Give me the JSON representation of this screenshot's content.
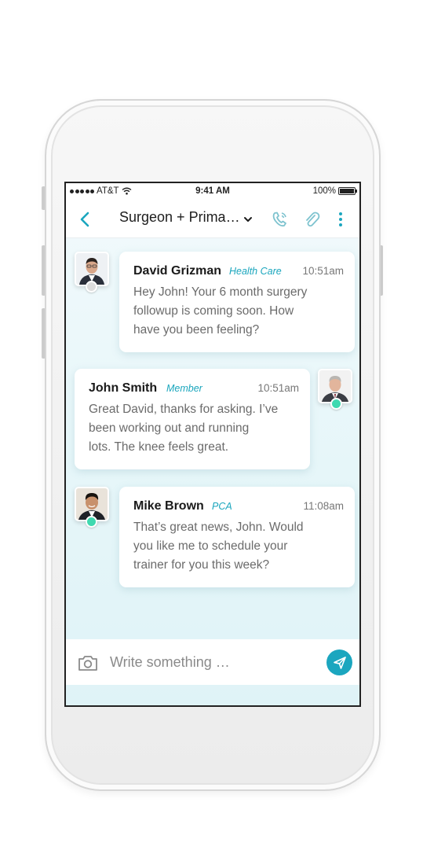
{
  "status_bar": {
    "carrier": "AT&T",
    "time": "9:41 AM",
    "battery": "100%"
  },
  "header": {
    "title": "Surgeon + Prima…",
    "icons": [
      "back-chevron-icon",
      "chevron-down-icon",
      "phone-icon",
      "paperclip-icon",
      "more-vertical-icon"
    ]
  },
  "messages": [
    {
      "sender": "David Grizman",
      "role": "Health Care",
      "time": "10:51am",
      "lines": [
        "Hey John! Your 6 month surgery",
        "followup is coming soon. How",
        "have you been feeling?"
      ],
      "presence": "offline"
    },
    {
      "sender": "John Smith",
      "role": "Member",
      "time": "10:51am",
      "lines": [
        "Great David, thanks for asking. I’ve",
        "been working out and running",
        "lots. The knee feels great."
      ],
      "presence": "online"
    },
    {
      "sender": "Mike Brown",
      "role": "PCA",
      "time": "11:08am",
      "lines": [
        "That’s great news, John. Would",
        "you like me to schedule your",
        "trainer for you this week?"
      ],
      "presence": "online"
    }
  ],
  "composer": {
    "placeholder": "Write something …",
    "icons": [
      "camera-icon",
      "send-icon"
    ]
  },
  "colors": {
    "accent": "#1ba6bf",
    "online": "#3fd9b0",
    "offline": "#dcdcdc",
    "background": "#e6f6f9",
    "send_button": "#1ba6bf"
  }
}
